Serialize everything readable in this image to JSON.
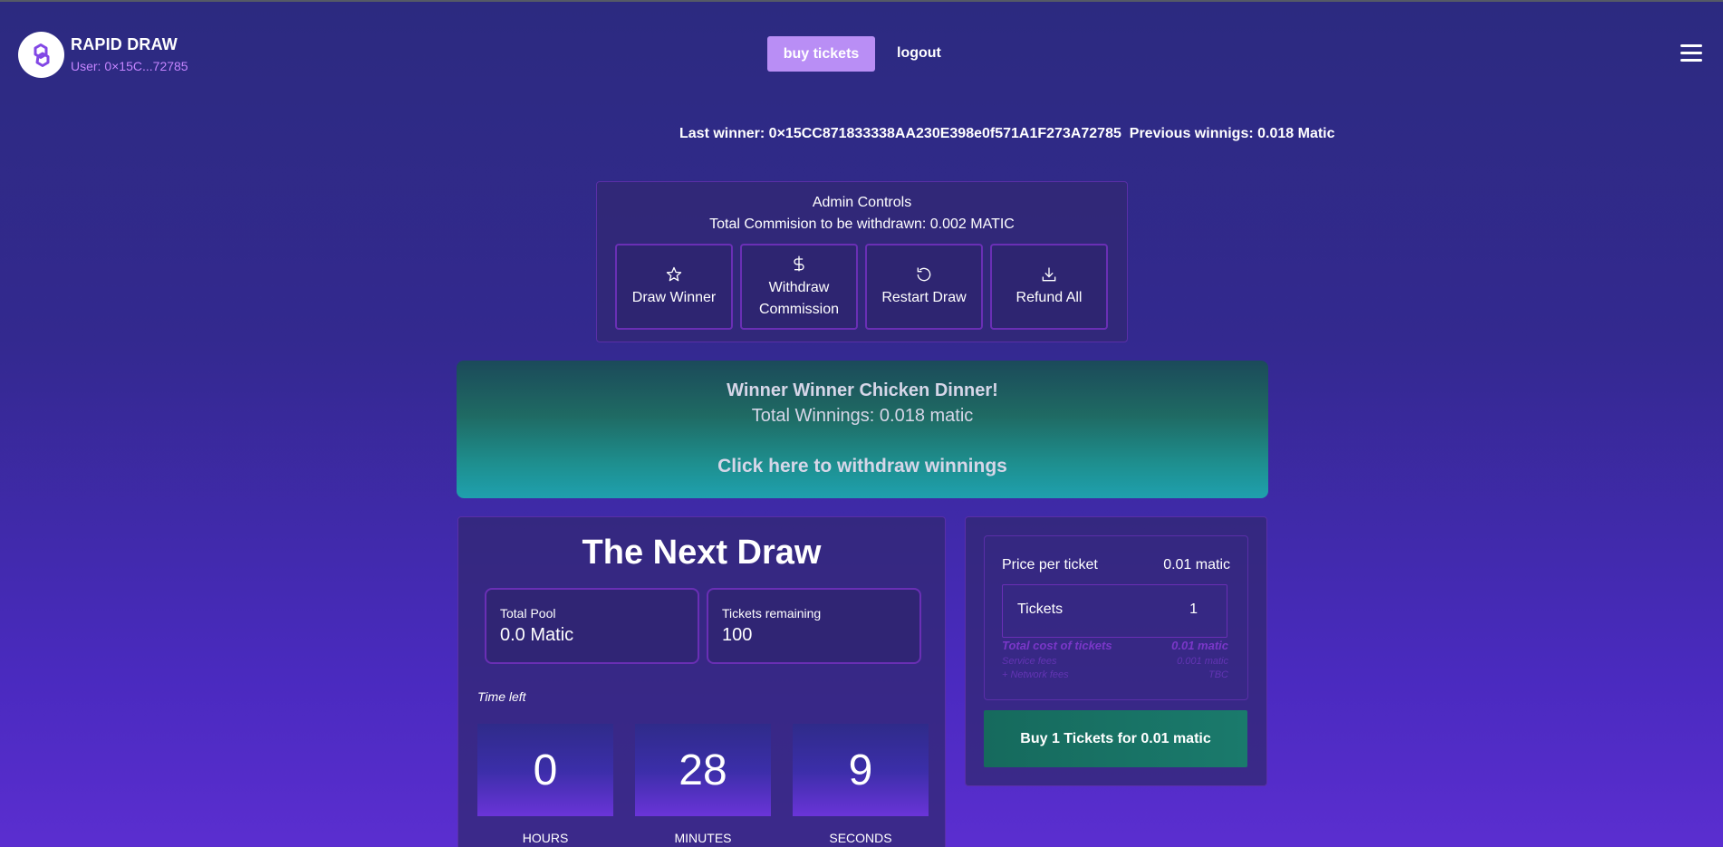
{
  "header": {
    "brand": "RAPID DRAW",
    "user": "User: 0×15C...72785",
    "buy_tickets": "buy tickets",
    "logout": "logout"
  },
  "last_winner": "Last winner: 0×15CC871833338AA230E398e0f571A1F273A72785  Previous winnigs: 0.018 Matic",
  "admin": {
    "title": "Admin Controls",
    "commission": "Total Commision to be withdrawn: 0.002 MATIC",
    "buttons": [
      {
        "label": "Draw Winner",
        "icon": "star-icon"
      },
      {
        "label": "Withdraw Commission",
        "icon": "dollar-icon"
      },
      {
        "label": "Restart Draw",
        "icon": "restart-icon"
      },
      {
        "label": "Refund All",
        "icon": "download-icon"
      }
    ]
  },
  "winner": {
    "title": "Winner Winner Chicken Dinner!",
    "total": "Total Winnings: 0.018 matic",
    "link": "Click here to withdraw winnings"
  },
  "next_draw": {
    "title": "The Next Draw",
    "total_pool_label": "Total Pool",
    "total_pool_value": "0.0 Matic",
    "tickets_remaining_label": "Tickets remaining",
    "tickets_remaining_value": "100",
    "time_left_label": "Time left",
    "countdown": [
      {
        "value": "0",
        "label": "HOURS"
      },
      {
        "value": "28",
        "label": "MINUTES"
      },
      {
        "value": "9",
        "label": "SECONDS"
      }
    ]
  },
  "ticket": {
    "price_label": "Price per ticket",
    "price_value": "0.01 matic",
    "tickets_label": "Tickets",
    "tickets_value": "1",
    "total_cost_label": "Total cost of tickets",
    "total_cost_value": "0.01 matic",
    "service_fees_label": "Service fees",
    "service_fees_value": "0.001 matic",
    "network_fees_label": "+ Network fees",
    "network_fees_value": "TBC",
    "buy_button": "Buy 1 Tickets for 0.01 matic"
  },
  "colors": {
    "accent": "#b98ef5",
    "border": "#6a2fb5",
    "winner_gradient_top": "#1b4a5a",
    "winner_gradient_bottom": "#1fa0ae",
    "buy_button": "#166a5d"
  }
}
